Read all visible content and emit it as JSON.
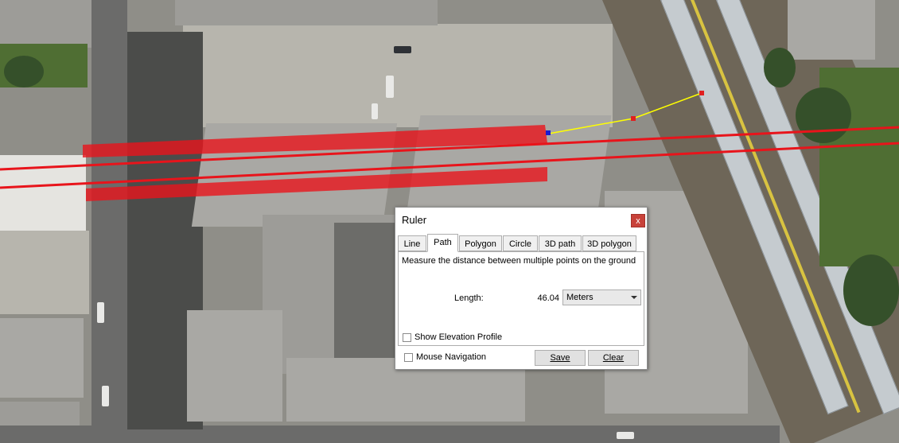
{
  "dialog": {
    "title": "Ruler",
    "close_label": "x",
    "tabs": [
      {
        "label": "Line",
        "active": false
      },
      {
        "label": "Path",
        "active": true
      },
      {
        "label": "Polygon",
        "active": false
      },
      {
        "label": "Circle",
        "active": false
      },
      {
        "label": "3D path",
        "active": false
      },
      {
        "label": "3D polygon",
        "active": false
      }
    ],
    "description": "Measure the distance between multiple points on the ground",
    "length_label": "Length:",
    "length_value": "46.04",
    "unit_selected": "Meters",
    "show_elevation_label": "Show Elevation Profile",
    "show_elevation_checked": false,
    "mouse_navigation_label": "Mouse Navigation",
    "mouse_navigation_checked": false,
    "save_label": "Save",
    "clear_label": "Clear"
  },
  "map": {
    "path_color": "#ffff00",
    "point_color": "#e02020",
    "overlay_color": "#e8141b",
    "overlay_fill": "rgba(232,20,27,0.78)"
  }
}
